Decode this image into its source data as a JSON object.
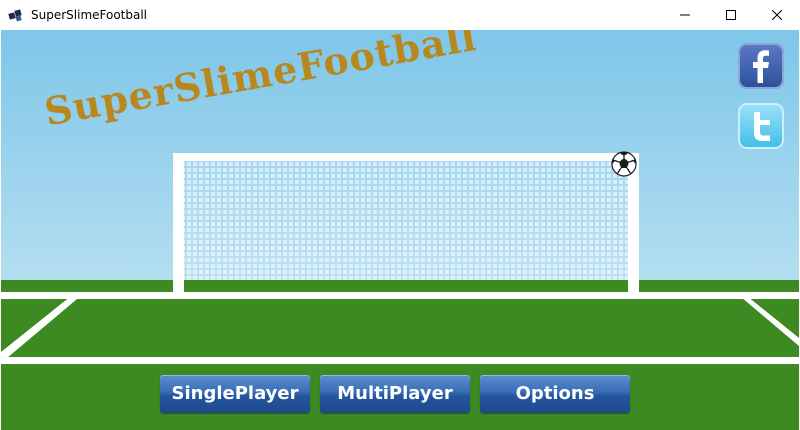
{
  "window": {
    "title": "SuperSlimeFootball",
    "controls": [
      "minimize",
      "maximize",
      "close"
    ]
  },
  "game": {
    "title": "SuperSlimeFootball",
    "social": [
      {
        "name": "facebook",
        "glyph": "f"
      },
      {
        "name": "twitter",
        "glyph": "t"
      }
    ],
    "menu": {
      "single_player": "SinglePlayer",
      "multi_player": "MultiPlayer",
      "options": "Options"
    }
  },
  "colors": {
    "sky_top": "#7ec6e9",
    "sky_bottom": "#b6dff0",
    "grass": "#3e8a22",
    "title": "#b8871e",
    "button": "#2e61a8"
  }
}
